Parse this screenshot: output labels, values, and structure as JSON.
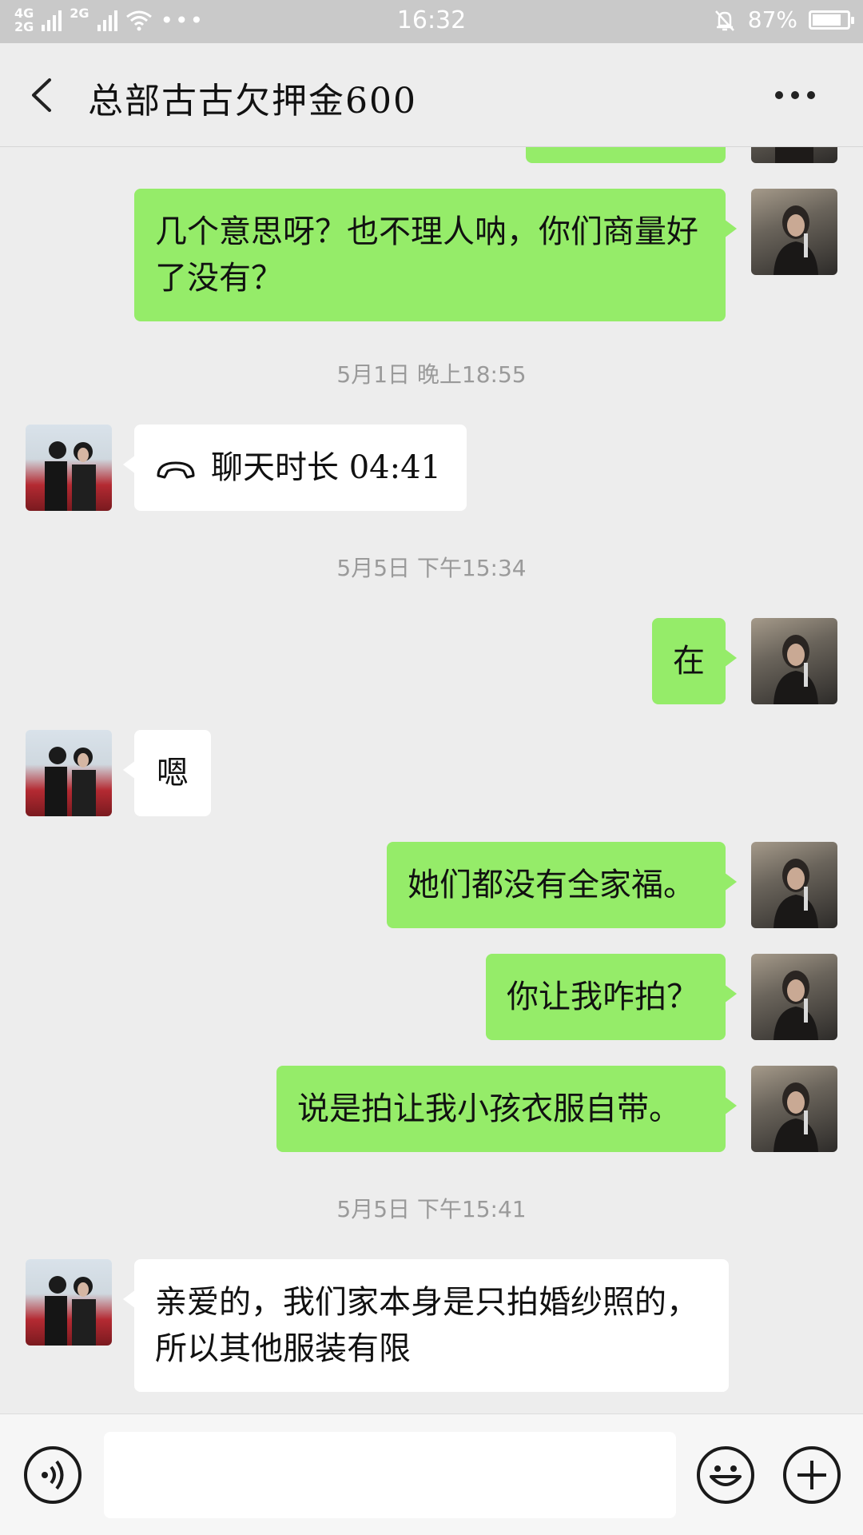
{
  "status_bar": {
    "network_top": "4G",
    "network_bottom": "2G",
    "network_2g": "2G",
    "time": "16:32",
    "battery_percent": "87%",
    "battery_level": 0.87
  },
  "header": {
    "title": "总部古古欠押金600"
  },
  "messages": {
    "m1": "几个意思呀？也不理人呐，你们商量好了没有？",
    "ts1": "5月1日 晚上18:55",
    "call": "聊天时长 04:41",
    "ts2": "5月5日 下午15:34",
    "m2": "在",
    "m3": "嗯",
    "m4": "她们都没有全家福。",
    "m5": "你让我咋拍？",
    "m6": "说是拍让我小孩衣服自带。",
    "ts3": "5月5日 下午15:41",
    "m7": "亲爱的，我们家本身是只拍婚纱照的，所以其他服装有限"
  },
  "input": {
    "value": "",
    "placeholder": ""
  },
  "icons": {
    "back": "chevron-left-icon",
    "more": "more-dots-icon",
    "voice": "voice-icon",
    "emoji": "emoji-icon",
    "plus": "plus-icon",
    "call": "phone-icon"
  },
  "colors": {
    "my_bubble": "#95ec69",
    "other_bubble": "#ffffff",
    "background": "#ededed"
  }
}
